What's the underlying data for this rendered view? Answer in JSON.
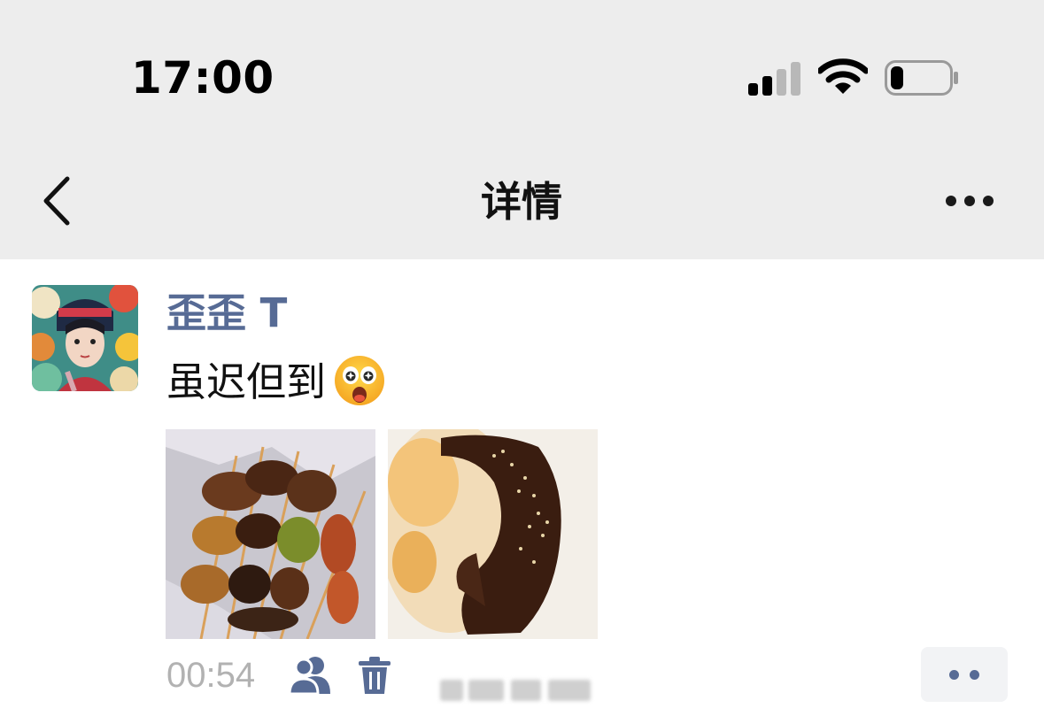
{
  "status_bar": {
    "time": "17:00",
    "icons": [
      "cellular-signal-icon",
      "wifi-icon",
      "battery-icon"
    ]
  },
  "nav": {
    "title": "详情",
    "back_icon": "chevron-left-icon",
    "more_icon": "ellipsis-icon"
  },
  "post": {
    "author": "歪歪 T",
    "text": "虽迟但到",
    "emoji": "starry-eyed-face-emoji",
    "photos": [
      {
        "name": "photo-grilled-skewers"
      },
      {
        "name": "photo-grilled-ribs"
      }
    ],
    "time": "00:54",
    "visibility_icon": "people-icon",
    "delete_icon": "trash-icon",
    "action_icon": "two-dots-icon"
  },
  "colors": {
    "header_bg": "#ededed",
    "name_link": "#576b95",
    "meta_gray": "#b2b2b2",
    "action_bg": "#f2f3f5"
  }
}
